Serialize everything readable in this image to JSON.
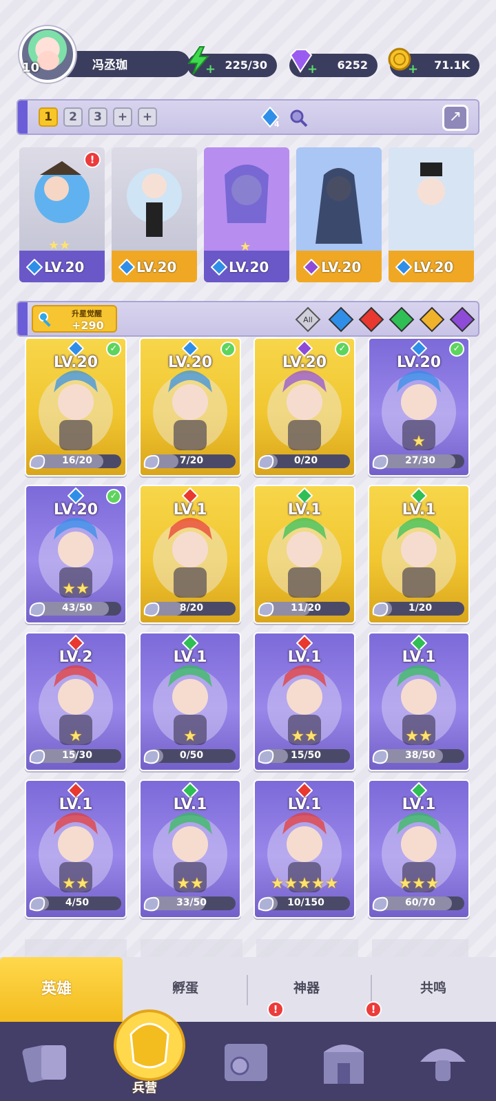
{
  "player": {
    "level": "10",
    "name": "冯丞珈"
  },
  "resources": [
    {
      "name": "energy",
      "value": "225/30",
      "color": "#3fd94f"
    },
    {
      "name": "diamond",
      "value": "6252",
      "color": "#9a5cf0"
    },
    {
      "name": "coin",
      "value": "71.1K",
      "color": "#f5c22a"
    }
  ],
  "team_tabs": [
    "1",
    "2",
    "3",
    "+",
    "+"
  ],
  "team_gem_count": "4",
  "team": [
    {
      "lv": "LV.20",
      "element": "water",
      "band": "purple",
      "stars": "★★",
      "alert": "!"
    },
    {
      "lv": "LV.20",
      "element": "water",
      "band": "gold",
      "stars": ""
    },
    {
      "lv": "LV.20",
      "element": "water",
      "band": "purple",
      "stars": "★"
    },
    {
      "lv": "LV.20",
      "element": "dark",
      "band": "gold",
      "stars": ""
    },
    {
      "lv": "LV.20",
      "element": "water",
      "band": "gold",
      "stars": ""
    }
  ],
  "awaken": {
    "title": "升星觉醒",
    "value": "+290"
  },
  "filters": [
    "All",
    "water",
    "fire",
    "wind",
    "light",
    "dark"
  ],
  "heroes": [
    {
      "lv": "LV.20",
      "element": "water",
      "frame": "gold",
      "progress": "16/20",
      "ratio": 0.8,
      "checked": true,
      "stars": ""
    },
    {
      "lv": "LV.20",
      "element": "water",
      "frame": "gold",
      "progress": "7/20",
      "ratio": 0.35,
      "checked": true,
      "stars": ""
    },
    {
      "lv": "LV.20",
      "element": "dark",
      "frame": "gold",
      "progress": "0/20",
      "ratio": 0,
      "checked": true,
      "stars": ""
    },
    {
      "lv": "LV.20",
      "element": "water",
      "frame": "purple",
      "progress": "27/30",
      "ratio": 0.9,
      "checked": true,
      "stars": "★"
    },
    {
      "lv": "LV.20",
      "element": "water",
      "frame": "purple",
      "progress": "43/50",
      "ratio": 0.86,
      "checked": true,
      "stars": "★★"
    },
    {
      "lv": "LV.1",
      "element": "fire",
      "frame": "gold",
      "progress": "8/20",
      "ratio": 0.4,
      "checked": false,
      "stars": ""
    },
    {
      "lv": "LV.1",
      "element": "wind",
      "frame": "gold",
      "progress": "11/20",
      "ratio": 0.55,
      "checked": false,
      "stars": ""
    },
    {
      "lv": "LV.1",
      "element": "wind",
      "frame": "gold",
      "progress": "1/20",
      "ratio": 0.05,
      "checked": false,
      "stars": ""
    },
    {
      "lv": "LV.2",
      "element": "fire",
      "frame": "purple",
      "progress": "15/30",
      "ratio": 0.5,
      "checked": false,
      "stars": "★"
    },
    {
      "lv": "LV.1",
      "element": "wind",
      "frame": "purple",
      "progress": "0/50",
      "ratio": 0,
      "checked": false,
      "stars": "★"
    },
    {
      "lv": "LV.1",
      "element": "fire",
      "frame": "purple",
      "progress": "15/50",
      "ratio": 0.3,
      "checked": false,
      "stars": "★★"
    },
    {
      "lv": "LV.1",
      "element": "wind",
      "frame": "purple",
      "progress": "38/50",
      "ratio": 0.76,
      "checked": false,
      "stars": "★★"
    },
    {
      "lv": "LV.1",
      "element": "fire",
      "frame": "purple",
      "progress": "4/50",
      "ratio": 0.08,
      "checked": false,
      "stars": "★★"
    },
    {
      "lv": "LV.1",
      "element": "wind",
      "frame": "purple",
      "progress": "33/50",
      "ratio": 0.66,
      "checked": false,
      "stars": "★★"
    },
    {
      "lv": "LV.1",
      "element": "fire",
      "frame": "purple",
      "progress": "10/150",
      "ratio": 0.07,
      "checked": false,
      "stars": "★★★★★"
    },
    {
      "lv": "LV.1",
      "element": "wind",
      "frame": "purple",
      "progress": "60/70",
      "ratio": 0.86,
      "checked": false,
      "stars": "★★★"
    }
  ],
  "tabs": {
    "hero": "英雄",
    "hatch": "孵蛋",
    "artifact": "神器",
    "resonance": "共鸣"
  },
  "nav": {
    "barracks": "兵营",
    "alert": "!"
  },
  "element_colors": {
    "water": "#2f8fe8",
    "fire": "#e8382f",
    "wind": "#2fbf55",
    "light": "#f0b22a",
    "dark": "#8e4bd8"
  }
}
